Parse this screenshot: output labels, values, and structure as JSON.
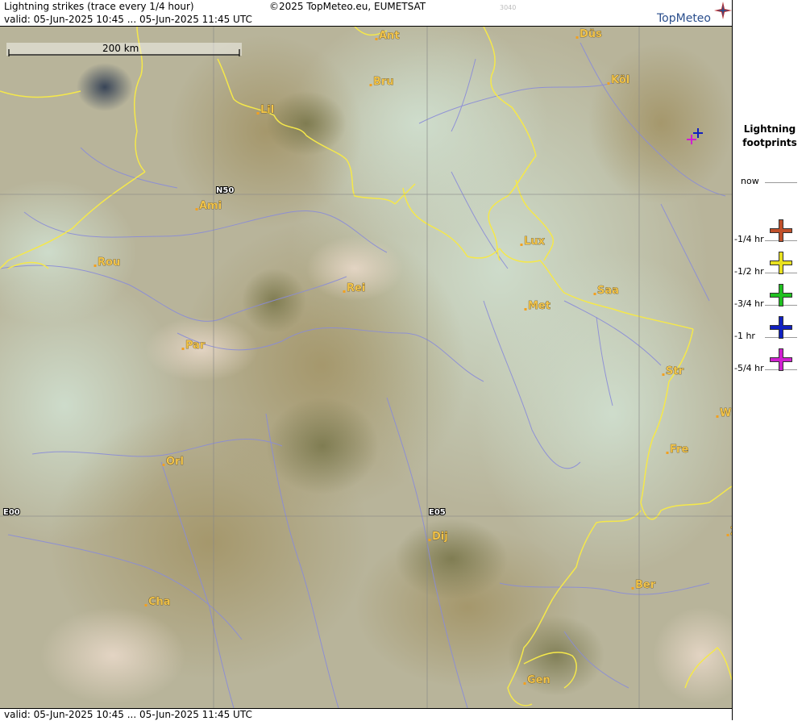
{
  "header": {
    "title": "Lightning strikes (trace every 1/4 hour)",
    "valid": "valid:  05-Jun-2025 10:45 ... 05-Jun-2025 11:45 UTC",
    "copyright": "©2025 TopMeteo.eu, EUMETSAT",
    "code": "3040",
    "logo": "TopMeteo"
  },
  "footer": {
    "valid": "valid:  05-Jun-2025 10:45 ... 05-Jun-2025 11:45 UTC"
  },
  "scale": {
    "label": "200 km"
  },
  "grid": {
    "n50": "N50",
    "e00": "E00",
    "e05": "E05"
  },
  "cities": [
    {
      "name": "Ant"
    },
    {
      "name": "Düs"
    },
    {
      "name": "Bru"
    },
    {
      "name": "Köl"
    },
    {
      "name": "Lil"
    },
    {
      "name": "Ami"
    },
    {
      "name": "Rou"
    },
    {
      "name": "Lux"
    },
    {
      "name": "Rei"
    },
    {
      "name": "Saa"
    },
    {
      "name": "Met"
    },
    {
      "name": "Par"
    },
    {
      "name": "Str"
    },
    {
      "name": "W"
    },
    {
      "name": "Fre"
    },
    {
      "name": "Orl"
    },
    {
      "name": "Dij"
    },
    {
      "name": "Ber"
    },
    {
      "name": "Cha"
    },
    {
      "name": "Gen"
    },
    {
      "name": "Z"
    }
  ],
  "legend": {
    "title_line1": "Lightning",
    "title_line2": "footprints",
    "items": [
      {
        "label": "now",
        "color": ""
      },
      {
        "label": "-1/4 hr",
        "color": "#c0502a"
      },
      {
        "label": "-1/2 hr",
        "color": "#e8e020"
      },
      {
        "label": "-3/4 hr",
        "color": "#20c020"
      },
      {
        "label": "-1 hr",
        "color": "#1020c0"
      },
      {
        "label": "-5/4 hr",
        "color": "#d020d0"
      }
    ]
  },
  "strikes": [
    {
      "age": "-1 hr",
      "color": "#1020c0"
    },
    {
      "age": "-5/4 hr",
      "color": "#d020d0"
    }
  ]
}
